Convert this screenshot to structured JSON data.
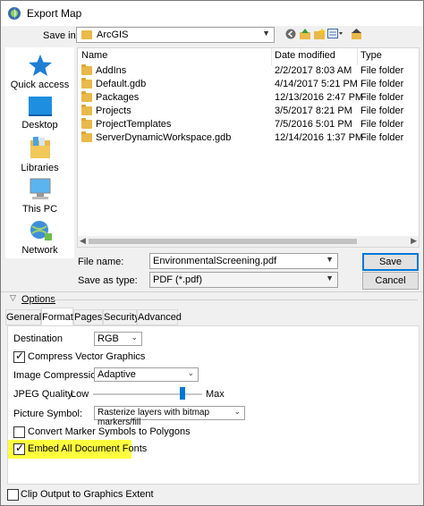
{
  "window": {
    "title": "Export Map"
  },
  "save_in": {
    "label": "Save in:",
    "value": "ArcGIS"
  },
  "places": [
    {
      "label": "Quick access",
      "icon": "star-icon"
    },
    {
      "label": "Desktop",
      "icon": "desktop-icon"
    },
    {
      "label": "Libraries",
      "icon": "libraries-icon"
    },
    {
      "label": "This PC",
      "icon": "computer-icon"
    },
    {
      "label": "Network",
      "icon": "network-icon"
    }
  ],
  "file_list": {
    "columns": [
      "Name",
      "Date modified",
      "Type"
    ],
    "rows": [
      {
        "name": "AddIns",
        "date": "2/2/2017 8:03 AM",
        "type": "File folder"
      },
      {
        "name": "Default.gdb",
        "date": "4/14/2017 5:21 PM",
        "type": "File folder"
      },
      {
        "name": "Packages",
        "date": "12/13/2016 2:47 PM",
        "type": "File folder"
      },
      {
        "name": "Projects",
        "date": "3/5/2017 8:21 PM",
        "type": "File folder"
      },
      {
        "name": "ProjectTemplates",
        "date": "7/5/2016 5:01 PM",
        "type": "File folder"
      },
      {
        "name": "ServerDynamicWorkspace.gdb",
        "date": "12/14/2016 1:37 PM",
        "type": "File folder"
      }
    ]
  },
  "file_name": {
    "label": "File name:",
    "value": "EnvironmentalScreening.pdf"
  },
  "save_as_type": {
    "label": "Save as type:",
    "value": "PDF (*.pdf)"
  },
  "buttons": {
    "save": "Save",
    "cancel": "Cancel"
  },
  "options": {
    "label": "Options",
    "tabs": [
      "General",
      "Format",
      "Pages",
      "Security",
      "Advanced"
    ],
    "active_tab": "Format",
    "destination": {
      "label": "Destination",
      "value": "RGB"
    },
    "compress_vector": {
      "label": "Compress Vector Graphics",
      "checked": true
    },
    "image_compression": {
      "label": "Image Compression:",
      "value": "Adaptive"
    },
    "jpeg_quality": {
      "label": "JPEG Quality:",
      "low": "Low",
      "high": "Max",
      "level": 0.82
    },
    "picture_symbol": {
      "label": "Picture Symbol:",
      "value": "Rasterize layers with bitmap markers/fill"
    },
    "convert_marker": {
      "label": "Convert Marker Symbols to Polygons",
      "checked": false
    },
    "embed_fonts": {
      "label": "Embed All Document Fonts",
      "checked": true,
      "highlight": "#ffff3e"
    }
  },
  "clip_output": {
    "label": "Clip Output to Graphics Extent",
    "checked": false
  }
}
